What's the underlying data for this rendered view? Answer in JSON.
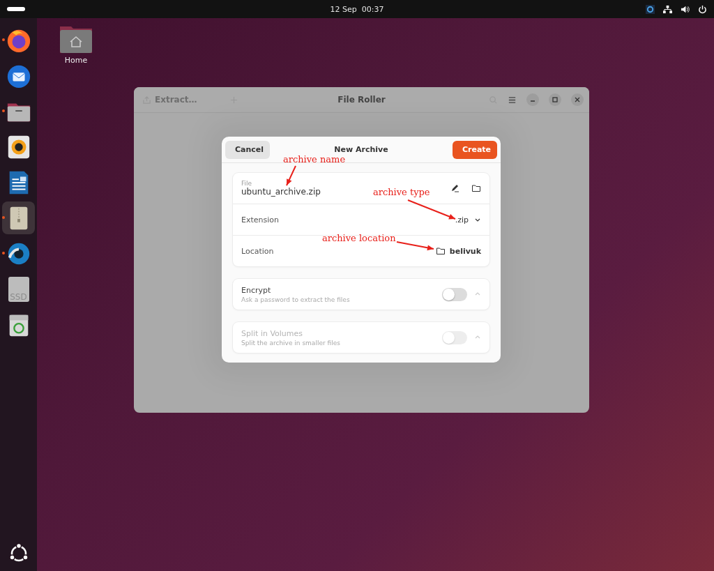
{
  "top_bar": {
    "date": "12 Sep",
    "time": "00:37"
  },
  "dock": {
    "items": [
      {
        "kind": "firefox",
        "running": true,
        "selected": false
      },
      {
        "kind": "thunderbird",
        "running": false,
        "selected": false
      },
      {
        "kind": "files",
        "running": true,
        "selected": false
      },
      {
        "kind": "rhythmbox",
        "running": false,
        "selected": false
      },
      {
        "kind": "writer",
        "running": false,
        "selected": false
      },
      {
        "kind": "archive",
        "running": true,
        "selected": true
      },
      {
        "kind": "shutter",
        "running": true,
        "selected": false
      },
      {
        "kind": "drive",
        "label": "SSD",
        "running": false,
        "selected": false
      },
      {
        "kind": "trash",
        "running": false,
        "selected": false
      }
    ]
  },
  "desktop_icons": [
    {
      "label": "Home"
    }
  ],
  "window": {
    "title": "File Roller",
    "toolbar_button": "Extract…"
  },
  "dialog": {
    "title": "New Archive",
    "cancel": "Cancel",
    "create": "Create",
    "file": {
      "label": "File",
      "value": "ubuntu_archive.zip"
    },
    "extension": {
      "label": "Extension",
      "value": ".zip"
    },
    "location": {
      "label": "Location",
      "value": "belivuk"
    },
    "options": [
      {
        "title": "Encrypt",
        "subtitle": "Ask a password to extract the files",
        "on": false,
        "disabled": false
      },
      {
        "title": "Split in Volumes",
        "subtitle": "Split the archive in smaller files",
        "on": false,
        "disabled": true
      }
    ]
  },
  "annotations": [
    {
      "text": "archive name"
    },
    {
      "text": "archive type"
    },
    {
      "text": "archive location"
    }
  ]
}
